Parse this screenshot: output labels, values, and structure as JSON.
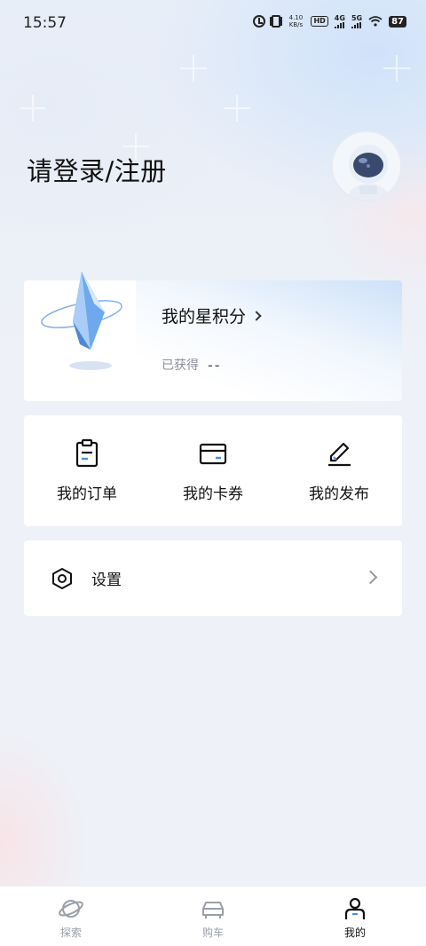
{
  "status_bar": {
    "time": "15:57",
    "speed_value": "4.10",
    "speed_unit": "KB/s",
    "hd_label": "HD",
    "network_1": "4G",
    "network_2": "5G",
    "battery": "87"
  },
  "header": {
    "login_title": "请登录/注册",
    "avatar_icon": "astronaut-avatar-icon"
  },
  "points_card": {
    "title": "我的星积分",
    "earned_label": "已获得",
    "earned_value": "--",
    "icon": "crystal-icon"
  },
  "shortcuts": [
    {
      "label": "我的订单",
      "icon": "clipboard-icon"
    },
    {
      "label": "我的卡券",
      "icon": "card-icon"
    },
    {
      "label": "我的发布",
      "icon": "pencil-icon"
    }
  ],
  "settings": {
    "label": "设置",
    "icon": "gear-icon"
  },
  "bottom_nav": {
    "items": [
      {
        "label": "探索",
        "icon": "planet-icon",
        "active": false
      },
      {
        "label": "购车",
        "icon": "car-icon",
        "active": false
      },
      {
        "label": "我的",
        "icon": "user-icon",
        "active": true
      }
    ]
  },
  "colors": {
    "background": "#eef1f7",
    "card": "#ffffff",
    "text_primary": "#111111",
    "text_secondary": "#8a8f99",
    "nav_inactive": "#9aa0a8",
    "accent_blue": "#4a90e2"
  }
}
